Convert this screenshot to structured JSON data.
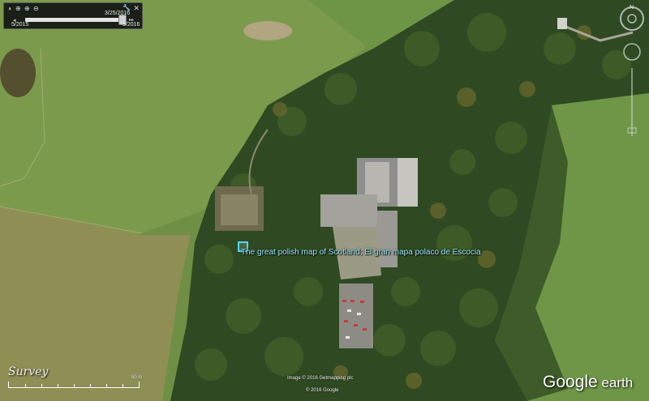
{
  "time_slider": {
    "current_date": "3/25/2016",
    "start_date": "5/2015",
    "end_date": "3/2016",
    "position": 0.97
  },
  "placemark": {
    "label": "The great polish map of Scotland; El gran mapa polaco de Escocia",
    "color": "#4fd8ff"
  },
  "overlay": {
    "survey_label": "Survey",
    "scale_label": "80 m"
  },
  "attribution": {
    "imagery": "Image © 2016 Getmapping plc",
    "copyright": "© 2016 Google"
  },
  "brand": {
    "part1": "Google",
    "part2": " earth"
  },
  "icons": {
    "sun": "sun-icon",
    "zoom_in": "zoom-in-icon",
    "zoom_out": "zoom-out-icon",
    "settings": "wrench-icon",
    "close": "close-icon",
    "compass": "compass-icon",
    "placemark": "placemark-square-icon"
  }
}
